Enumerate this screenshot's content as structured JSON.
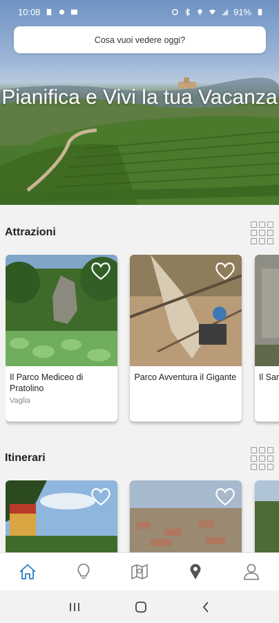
{
  "status_bar": {
    "time": "10:08",
    "battery": "91%"
  },
  "search": {
    "placeholder": "Cosa vuoi vedere oggi?"
  },
  "hero": {
    "title": "Pianifica e Vivi la tua Vacanza"
  },
  "sections": {
    "attractions": {
      "title": "Attrazioni",
      "cards": [
        {
          "title": "Il Parco Mediceo di Pratolino",
          "subtitle": "Vaglia"
        },
        {
          "title": "Parco Avventura il Gigante",
          "subtitle": ""
        },
        {
          "title": "Il Santu Montes",
          "subtitle": ""
        }
      ]
    },
    "itineraries": {
      "title": "Itinerari"
    }
  },
  "bottom_nav": [
    "home-icon",
    "lightbulb-icon",
    "map-icon",
    "location-pin-icon",
    "profile-icon"
  ],
  "colors": {
    "accent": "#2f7dc0",
    "nav_icon": "#7a7a7a"
  }
}
